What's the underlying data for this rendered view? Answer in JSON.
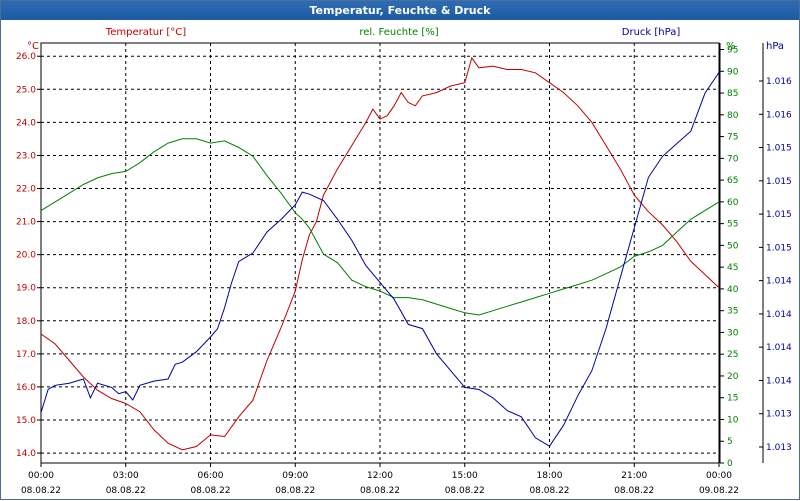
{
  "window": {
    "title": "Temperatur, Feuchte & Druck"
  },
  "colors": {
    "temperature": "#c00000",
    "humidity": "#008000",
    "pressure": "#0000a0",
    "grid": "#000000"
  },
  "chart_data": {
    "type": "line",
    "title": "Temperatur, Feuchte & Druck",
    "grid": true,
    "x_labels": [
      {
        "time": "00:00",
        "date": "08.08.22"
      },
      {
        "time": "03:00",
        "date": "08.08.22"
      },
      {
        "time": "06:00",
        "date": "08.08.22"
      },
      {
        "time": "09:00",
        "date": "08.08.22"
      },
      {
        "time": "12:00",
        "date": "08.08.22"
      },
      {
        "time": "15:00",
        "date": "08.08.22"
      },
      {
        "time": "18:00",
        "date": "08.08.22"
      },
      {
        "time": "21:00",
        "date": "08.08.22"
      },
      {
        "time": "00:00",
        "date": "09.08.22"
      }
    ],
    "x_range_hours": [
      0,
      24
    ],
    "axes": {
      "temperature": {
        "legend": "Temperatur [°C]",
        "unit": "°C",
        "range": [
          13.7,
          26.4
        ],
        "ticks": [
          "14.0",
          "15.0",
          "16.0",
          "17.0",
          "18.0",
          "19.0",
          "20.0",
          "21.0",
          "22.0",
          "23.0",
          "24.0",
          "25.0",
          "26.0"
        ]
      },
      "humidity": {
        "legend": "rel. Feuchte [%]",
        "unit": "%",
        "range": [
          0,
          96.5
        ],
        "ticks": [
          "0",
          "5",
          "10",
          "15",
          "20",
          "25",
          "30",
          "35",
          "40",
          "45",
          "50",
          "55",
          "60",
          "65",
          "70",
          "75",
          "80",
          "85",
          "90",
          "95"
        ]
      },
      "pressure": {
        "legend": "Druck [hPa]",
        "unit": "hPa",
        "ticks": [
          "1.013",
          "1.013",
          "1.014",
          "1.014",
          "1.014",
          "1.014",
          "1.015",
          "1.015",
          "1.015",
          "1.015",
          "1.016",
          "1.016"
        ]
      }
    },
    "series": [
      {
        "name": "Temperatur [°C]",
        "axis": "temperature",
        "points": [
          [
            0,
            17.6
          ],
          [
            0.5,
            17.3
          ],
          [
            1,
            16.8
          ],
          [
            1.5,
            16.3
          ],
          [
            2,
            15.9
          ],
          [
            2.5,
            15.65
          ],
          [
            3,
            15.5
          ],
          [
            3.5,
            15.25
          ],
          [
            4,
            14.7
          ],
          [
            4.5,
            14.3
          ],
          [
            5,
            14.1
          ],
          [
            5.5,
            14.2
          ],
          [
            6,
            14.55
          ],
          [
            6.5,
            14.5
          ],
          [
            7,
            15.1
          ],
          [
            7.5,
            15.6
          ],
          [
            8,
            16.8
          ],
          [
            8.5,
            17.8
          ],
          [
            9,
            18.9
          ],
          [
            9.25,
            19.85
          ],
          [
            9.5,
            20.6
          ],
          [
            9.75,
            21.0
          ],
          [
            10,
            21.8
          ],
          [
            10.5,
            22.6
          ],
          [
            11,
            23.3
          ],
          [
            11.5,
            24.0
          ],
          [
            11.75,
            24.4
          ],
          [
            12,
            24.1
          ],
          [
            12.25,
            24.2
          ],
          [
            12.5,
            24.5
          ],
          [
            12.75,
            24.9
          ],
          [
            13,
            24.6
          ],
          [
            13.25,
            24.5
          ],
          [
            13.5,
            24.8
          ],
          [
            14,
            24.9
          ],
          [
            14.5,
            25.1
          ],
          [
            15,
            25.2
          ],
          [
            15.25,
            25.95
          ],
          [
            15.5,
            25.65
          ],
          [
            16,
            25.7
          ],
          [
            16.5,
            25.6
          ],
          [
            17,
            25.6
          ],
          [
            17.5,
            25.5
          ],
          [
            18,
            25.2
          ],
          [
            18.5,
            24.9
          ],
          [
            19,
            24.5
          ],
          [
            19.5,
            24.0
          ],
          [
            20,
            23.3
          ],
          [
            20.5,
            22.6
          ],
          [
            21,
            21.8
          ],
          [
            21.5,
            21.3
          ],
          [
            22,
            20.9
          ],
          [
            22.5,
            20.4
          ],
          [
            23,
            19.8
          ],
          [
            23.5,
            19.4
          ],
          [
            24,
            19.0
          ]
        ]
      },
      {
        "name": "rel. Feuchte [%]",
        "axis": "humidity",
        "points": [
          [
            0,
            58
          ],
          [
            0.5,
            60
          ],
          [
            1,
            62
          ],
          [
            1.5,
            64
          ],
          [
            2,
            65.5
          ],
          [
            2.5,
            66.5
          ],
          [
            3,
            67
          ],
          [
            3.5,
            69
          ],
          [
            4,
            71.5
          ],
          [
            4.5,
            73.5
          ],
          [
            5,
            74.5
          ],
          [
            5.5,
            74.5
          ],
          [
            6,
            73.5
          ],
          [
            6.5,
            74
          ],
          [
            7,
            72.5
          ],
          [
            7.5,
            70.5
          ],
          [
            8,
            66
          ],
          [
            8.5,
            62
          ],
          [
            9,
            57.5
          ],
          [
            9.25,
            56
          ],
          [
            9.5,
            54
          ],
          [
            10,
            48
          ],
          [
            10.5,
            46
          ],
          [
            11,
            42
          ],
          [
            11.5,
            40.5
          ],
          [
            12,
            39.5
          ],
          [
            12.5,
            38
          ],
          [
            13,
            38
          ],
          [
            13.5,
            37.5
          ],
          [
            14,
            36.5
          ],
          [
            14.5,
            35.5
          ],
          [
            15,
            34.5
          ],
          [
            15.5,
            34
          ],
          [
            16,
            35
          ],
          [
            16.5,
            36
          ],
          [
            17,
            37
          ],
          [
            17.5,
            38
          ],
          [
            18,
            39
          ],
          [
            18.5,
            40
          ],
          [
            19,
            41
          ],
          [
            19.5,
            42
          ],
          [
            20,
            43.5
          ],
          [
            20.5,
            45
          ],
          [
            21,
            47.5
          ],
          [
            21.5,
            48.5
          ],
          [
            22,
            50
          ],
          [
            22.5,
            53
          ],
          [
            23,
            56
          ],
          [
            23.5,
            58
          ],
          [
            24,
            60
          ]
        ]
      },
      {
        "name": "Druck [hPa]",
        "axis": "pressure",
        "y_scale": "0-1 of plot height, 1 = top",
        "points": [
          [
            0,
            0.12
          ],
          [
            0.25,
            0.175
          ],
          [
            0.5,
            0.185
          ],
          [
            1,
            0.19
          ],
          [
            1.5,
            0.2
          ],
          [
            1.75,
            0.155
          ],
          [
            2,
            0.19
          ],
          [
            2.5,
            0.18
          ],
          [
            2.75,
            0.165
          ],
          [
            3,
            0.17
          ],
          [
            3.25,
            0.15
          ],
          [
            3.5,
            0.185
          ],
          [
            4,
            0.195
          ],
          [
            4.5,
            0.2
          ],
          [
            4.75,
            0.235
          ],
          [
            5,
            0.24
          ],
          [
            5.5,
            0.265
          ],
          [
            6,
            0.3
          ],
          [
            6.25,
            0.32
          ],
          [
            6.5,
            0.37
          ],
          [
            6.75,
            0.43
          ],
          [
            7,
            0.48
          ],
          [
            7.5,
            0.5
          ],
          [
            8,
            0.55
          ],
          [
            8.5,
            0.58
          ],
          [
            9,
            0.615
          ],
          [
            9.25,
            0.645
          ],
          [
            9.5,
            0.64
          ],
          [
            10,
            0.625
          ],
          [
            10.5,
            0.58
          ],
          [
            11,
            0.53
          ],
          [
            11.5,
            0.47
          ],
          [
            12,
            0.43
          ],
          [
            12.5,
            0.39
          ],
          [
            13,
            0.33
          ],
          [
            13.5,
            0.32
          ],
          [
            14,
            0.26
          ],
          [
            14.5,
            0.22
          ],
          [
            15,
            0.18
          ],
          [
            15.5,
            0.175
          ],
          [
            16,
            0.155
          ],
          [
            16.5,
            0.125
          ],
          [
            17,
            0.11
          ],
          [
            17.5,
            0.06
          ],
          [
            18,
            0.04
          ],
          [
            18.5,
            0.09
          ],
          [
            19,
            0.16
          ],
          [
            19.5,
            0.22
          ],
          [
            20,
            0.32
          ],
          [
            20.5,
            0.44
          ],
          [
            21,
            0.56
          ],
          [
            21.5,
            0.68
          ],
          [
            22,
            0.73
          ],
          [
            22.5,
            0.76
          ],
          [
            23,
            0.79
          ],
          [
            23.5,
            0.88
          ],
          [
            24,
            0.93
          ]
        ]
      }
    ]
  }
}
